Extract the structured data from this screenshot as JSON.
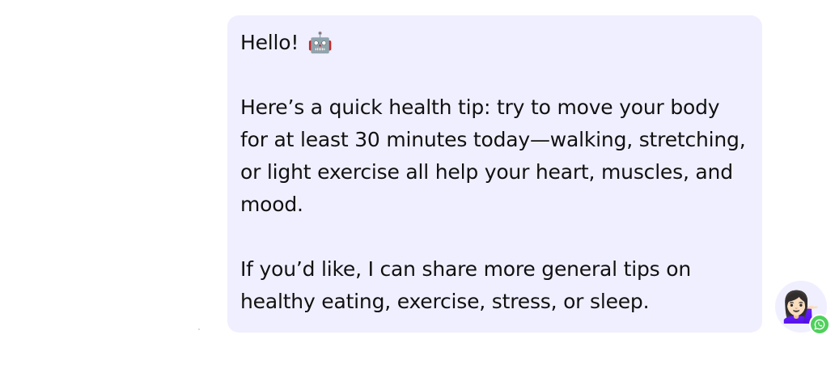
{
  "message": {
    "greeting": "Hello!",
    "greeting_emoji": "🤖",
    "paragraph_1": "Here’s a quick health tip: try to move your body for at least 30 minutes today—walking, stretching, or light exercise all help your heart, muscles, and mood.",
    "paragraph_2": "If you’d like, I can share more general tips on healthy eating, exercise, stress, or sleep."
  },
  "avatar": {
    "emoji": "💁🏻‍♀️",
    "badge_icon": "whatsapp-icon",
    "badge_color": "#4fd05c"
  },
  "colors": {
    "bubble_background": "#f0efff",
    "text": "#111111"
  }
}
